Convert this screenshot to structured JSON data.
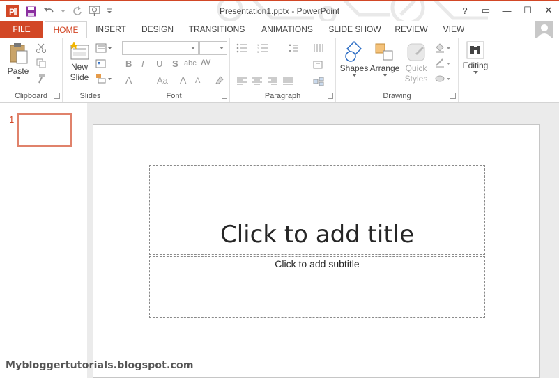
{
  "window": {
    "title": "Presentation1.pptx - PowerPoint",
    "help_label": "?",
    "ribbon_display_label": "▭",
    "minimize_label": "—",
    "maximize_label": "☐",
    "close_label": "✕"
  },
  "qat": {
    "app_icon": "powerpoint-icon",
    "save_icon": "save-icon",
    "undo_icon": "undo-icon",
    "redo_icon": "redo-icon",
    "start_from_beginning_icon": "slideshow-start-icon",
    "customize_icon": "chevron-down-icon"
  },
  "tabs": {
    "file": "FILE",
    "home": "HOME",
    "insert": "INSERT",
    "design": "DESIGN",
    "transitions": "TRANSITIONS",
    "animations": "ANIMATIONS",
    "slide_show": "SLIDE SHOW",
    "review": "REVIEW",
    "view": "VIEW"
  },
  "ribbon": {
    "clipboard": {
      "label": "Clipboard",
      "paste": "Paste"
    },
    "slides": {
      "label": "Slides",
      "new_slide_line1": "New",
      "new_slide_line2": "Slide"
    },
    "font": {
      "label": "Font",
      "bold": "B",
      "italic": "I",
      "underline": "U",
      "shadow": "S",
      "strike": "abc",
      "spacing": "AV",
      "case": "Aa",
      "color": "A",
      "grow": "A",
      "shrink": "A"
    },
    "paragraph": {
      "label": "Paragraph"
    },
    "drawing": {
      "label": "Drawing",
      "shapes": "Shapes",
      "arrange": "Arrange",
      "quick_line1": "Quick",
      "quick_line2": "Styles"
    },
    "editing": {
      "label": "Editing"
    }
  },
  "thumbnails": [
    {
      "number": "1"
    }
  ],
  "slide": {
    "title_placeholder": "Click to add title",
    "subtitle_placeholder": "Click to add subtitle"
  },
  "watermark": "Mybloggertutorials.blogspot.com",
  "colors": {
    "accent": "#d24726",
    "thumb_border": "#e0826b"
  }
}
